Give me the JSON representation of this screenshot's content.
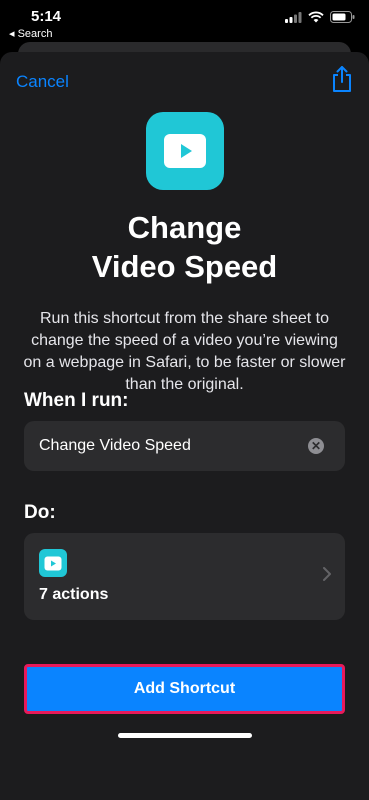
{
  "status_bar": {
    "time": "5:14",
    "back_app": "◂ Search"
  },
  "header": {
    "cancel_label": "Cancel"
  },
  "shortcut": {
    "title_line1": "Change",
    "title_line2": "Video Speed",
    "description": "Run this shortcut from the share sheet to change the speed of a video you’re viewing on a webpage in Safari, to be faster or slower than the original.",
    "icon_color": "#20c7d6"
  },
  "when_run": {
    "label": "When I run:",
    "name_value": "Change Video Speed"
  },
  "do_section": {
    "label": "Do:",
    "actions_count": "7 actions"
  },
  "footer": {
    "add_label": "Add Shortcut",
    "accent": "#0a84ff",
    "highlight": "#e8195a"
  }
}
